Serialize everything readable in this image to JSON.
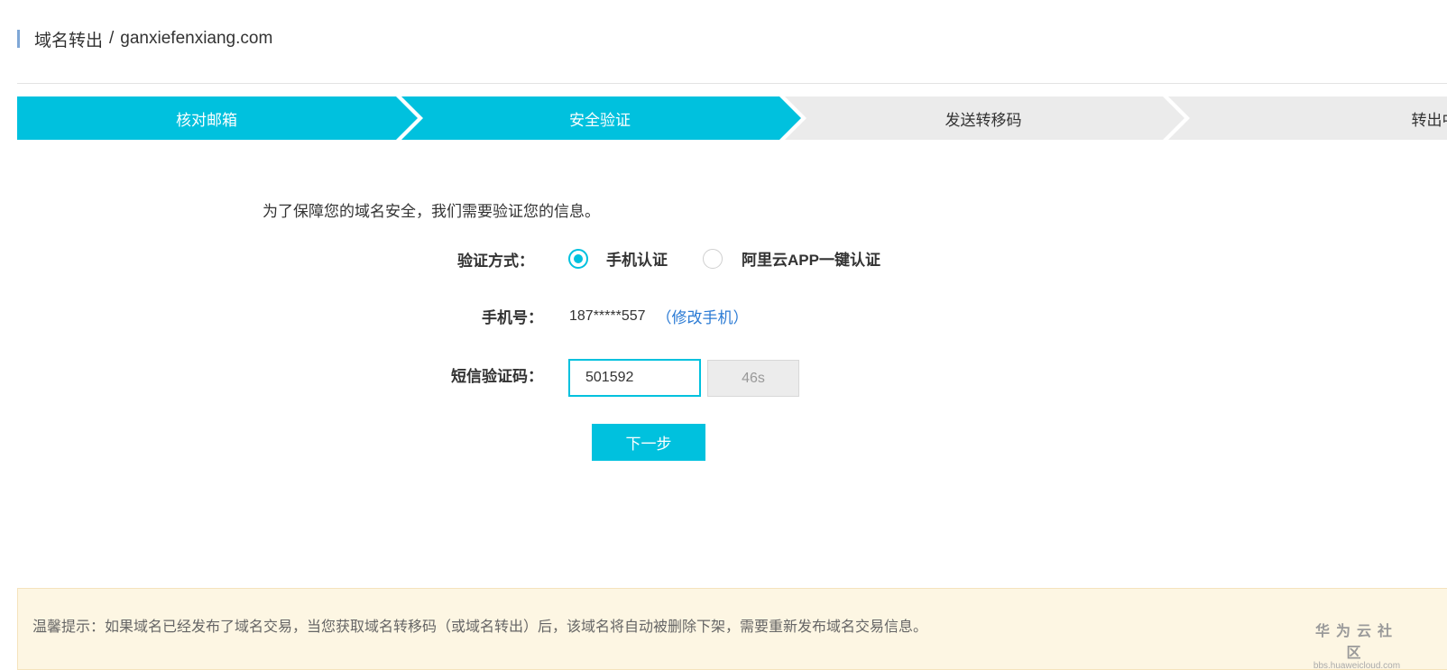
{
  "header": {
    "title": "域名转出",
    "separator": "/",
    "domain": "ganxiefenxiang.com"
  },
  "steps": [
    {
      "label": "核对邮箱",
      "state": "done"
    },
    {
      "label": "安全验证",
      "state": "current"
    },
    {
      "label": "发送转移码",
      "state": "pending"
    },
    {
      "label": "转出中",
      "state": "pending"
    }
  ],
  "colors": {
    "accent": "#00c1de",
    "inactive_step": "#ebebeb",
    "link": "#2a7ad4",
    "notice_bg": "#fdf6e3"
  },
  "form": {
    "intro": "为了保障您的域名安全，我们需要验证您的信息。",
    "method_label": "验证方式：",
    "methods": [
      {
        "label": "手机认证",
        "checked": true
      },
      {
        "label": "阿里云APP一键认证",
        "checked": false
      }
    ],
    "phone_label": "手机号：",
    "phone_value": "187*****557",
    "change_phone_link": "（修改手机）",
    "sms_label": "短信验证码：",
    "sms_value": "501592",
    "countdown": "46s",
    "next_button": "下一步"
  },
  "notice": {
    "text": "温馨提示：如果域名已经发布了域名交易，当您获取域名转移码（或域名转出）后，该域名将自动被删除下架，需要重新发布域名交易信息。"
  },
  "watermark": {
    "name": "华为云社区",
    "url": "bbs.huaweicloud.com"
  }
}
